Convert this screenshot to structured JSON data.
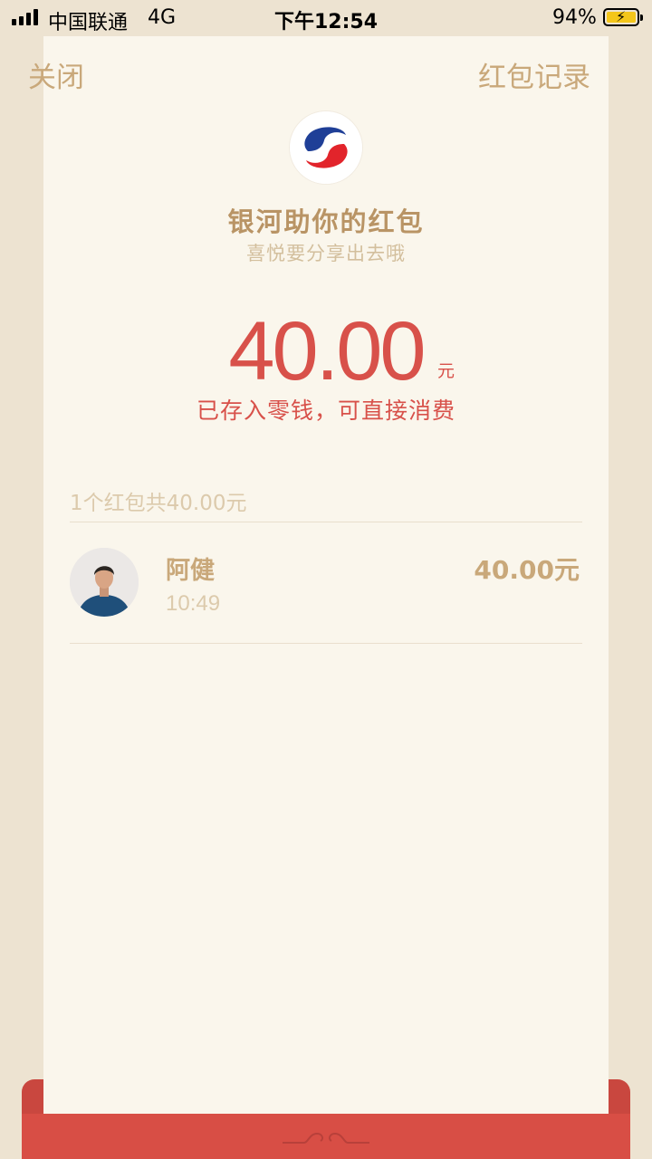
{
  "status_bar": {
    "carrier": "中国联通",
    "network": "4G",
    "time": "下午12:54",
    "battery": "94%"
  },
  "header": {
    "close_label": "关闭",
    "records_label": "红包记录"
  },
  "packet": {
    "title": "银河助你的红包",
    "subtitle": "喜悦要分享出去哦",
    "amount": "40.00",
    "unit": "元",
    "note": "已存入零钱，可直接消费"
  },
  "list": {
    "summary": "1个红包共40.00元",
    "items": [
      {
        "name": "阿健",
        "time": "10:49",
        "amount": "40.00元"
      }
    ]
  },
  "colors": {
    "accent_red": "#d8514a",
    "gold": "#c9a87a",
    "background": "#faf6ec"
  }
}
